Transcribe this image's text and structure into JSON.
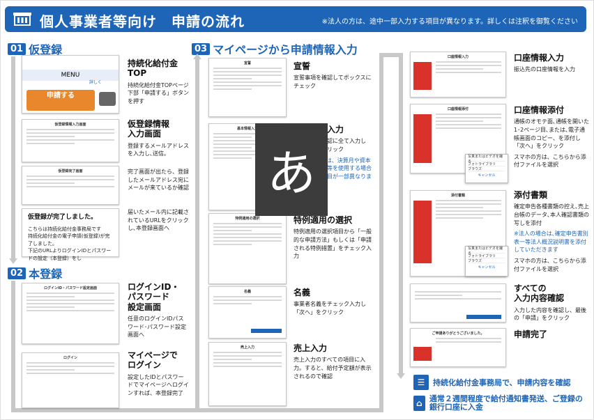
{
  "header": {
    "title": "個人事業者等向け　申請の流れ",
    "note": "※法人の方は、途中一部入力する項目が異なります。詳しくは注釈を御覧ください"
  },
  "sections": [
    {
      "num": "01",
      "title": "仮登録"
    },
    {
      "num": "02",
      "title": "本登録"
    },
    {
      "num": "03",
      "title": "マイページから申請情報入力"
    }
  ],
  "col1": {
    "topThumb": {
      "menu": "MENU",
      "apply": "申請する",
      "small": "詳しく"
    },
    "steps": [
      {
        "title": "持続化給付金\nTOP",
        "desc": "持続化給付金TOPページ下部「申請する」ボタンを押す"
      },
      {
        "title": "仮登録情報\n入力画面",
        "desc": "登録するメールアドレスを入力し､送信。"
      },
      {
        "title": "",
        "desc": "完了画面が出たら、登録したメールアドレス宛にメールが来ているか確認"
      },
      {
        "title": "",
        "desc": "届いたメール内に記載されているURLをクリックし､本登録画面へ"
      },
      {
        "title": "ログインID・\nパスワード\n設定画面",
        "desc": "任意のログインIDパスワード･パスワード設定画面へ"
      },
      {
        "title": "マイページで\nログイン",
        "desc": "設定したIDとパスワードでマイページへログインすれば、本登録完了"
      }
    ],
    "card": {
      "heading": "仮登録が完了しました。",
      "body": "こちらは持続化給付金事務局です\n持続化給付金の電子申請(仮登録)が完了しました。\n下記のURLよりログインIDとパスワードの設定（本登録）をし"
    }
  },
  "col2": {
    "steps": [
      {
        "title": "宣誓",
        "desc": "宣誓事項を確認してボックスにチェック"
      },
      {
        "title": "基本情報入力",
        "desc": "基本情報を確認に全て入力し「次へ」をクリック",
        "extra": "※法人の場合は、決算月や資本金、法人番号等を使用する場合など入力の項目が一部異なります"
      },
      {
        "title": "特例適用の選択",
        "desc": "特例適用の選択項目から「一般的な申請方法」もしくは「申請される特例措置」をチェック入力"
      },
      {
        "title": "名義",
        "desc": "事業者名義をチェック入力し「次へ」をクリック"
      },
      {
        "title": "売上入力",
        "desc": "売上入力のすべての項目に入力。すると、給付予定額が表示されるので確認"
      }
    ]
  },
  "col3": {
    "steps": [
      {
        "title": "口座情報入力",
        "desc": "振込先の口座情報を入力"
      },
      {
        "title": "口座情報添付",
        "desc": "通帳のオモテ面､通帳を開いた1･2ページ目､または､電子通帳画面のコピー、を添付し「次へ」をクリック",
        "extra": "スマホの方は、こちらから添付ファイルを選択"
      },
      {
        "title": "添付書類",
        "desc": "確定申告各種書類の控え､売上台帳のデータ､本人確認書類の写しを添付",
        "note": "※法人の場合は､確定申告書別表一等法人概況説明書を添付していただきます",
        "extra": "スマホの方は、こちらから添付ファイルを選択"
      },
      {
        "title": "すべての\n入力内容確認",
        "desc": "入力した内容を確認し、最後の「申請」をクリック"
      },
      {
        "title": "申請完了",
        "desc": ""
      }
    ],
    "footer": [
      {
        "text": "持続化給付金事務局で、申請内容を確認"
      },
      {
        "text": "通常２週間程度で給付通知書発送、ご登録の銀行口座に入金"
      }
    ],
    "phone": {
      "rows": [
        "写真またはビデオを撮る",
        "フォトライブラリ",
        "ブラウズ"
      ],
      "cancel": "キャンセル"
    }
  },
  "overlay": {
    "glyph": "あ"
  }
}
